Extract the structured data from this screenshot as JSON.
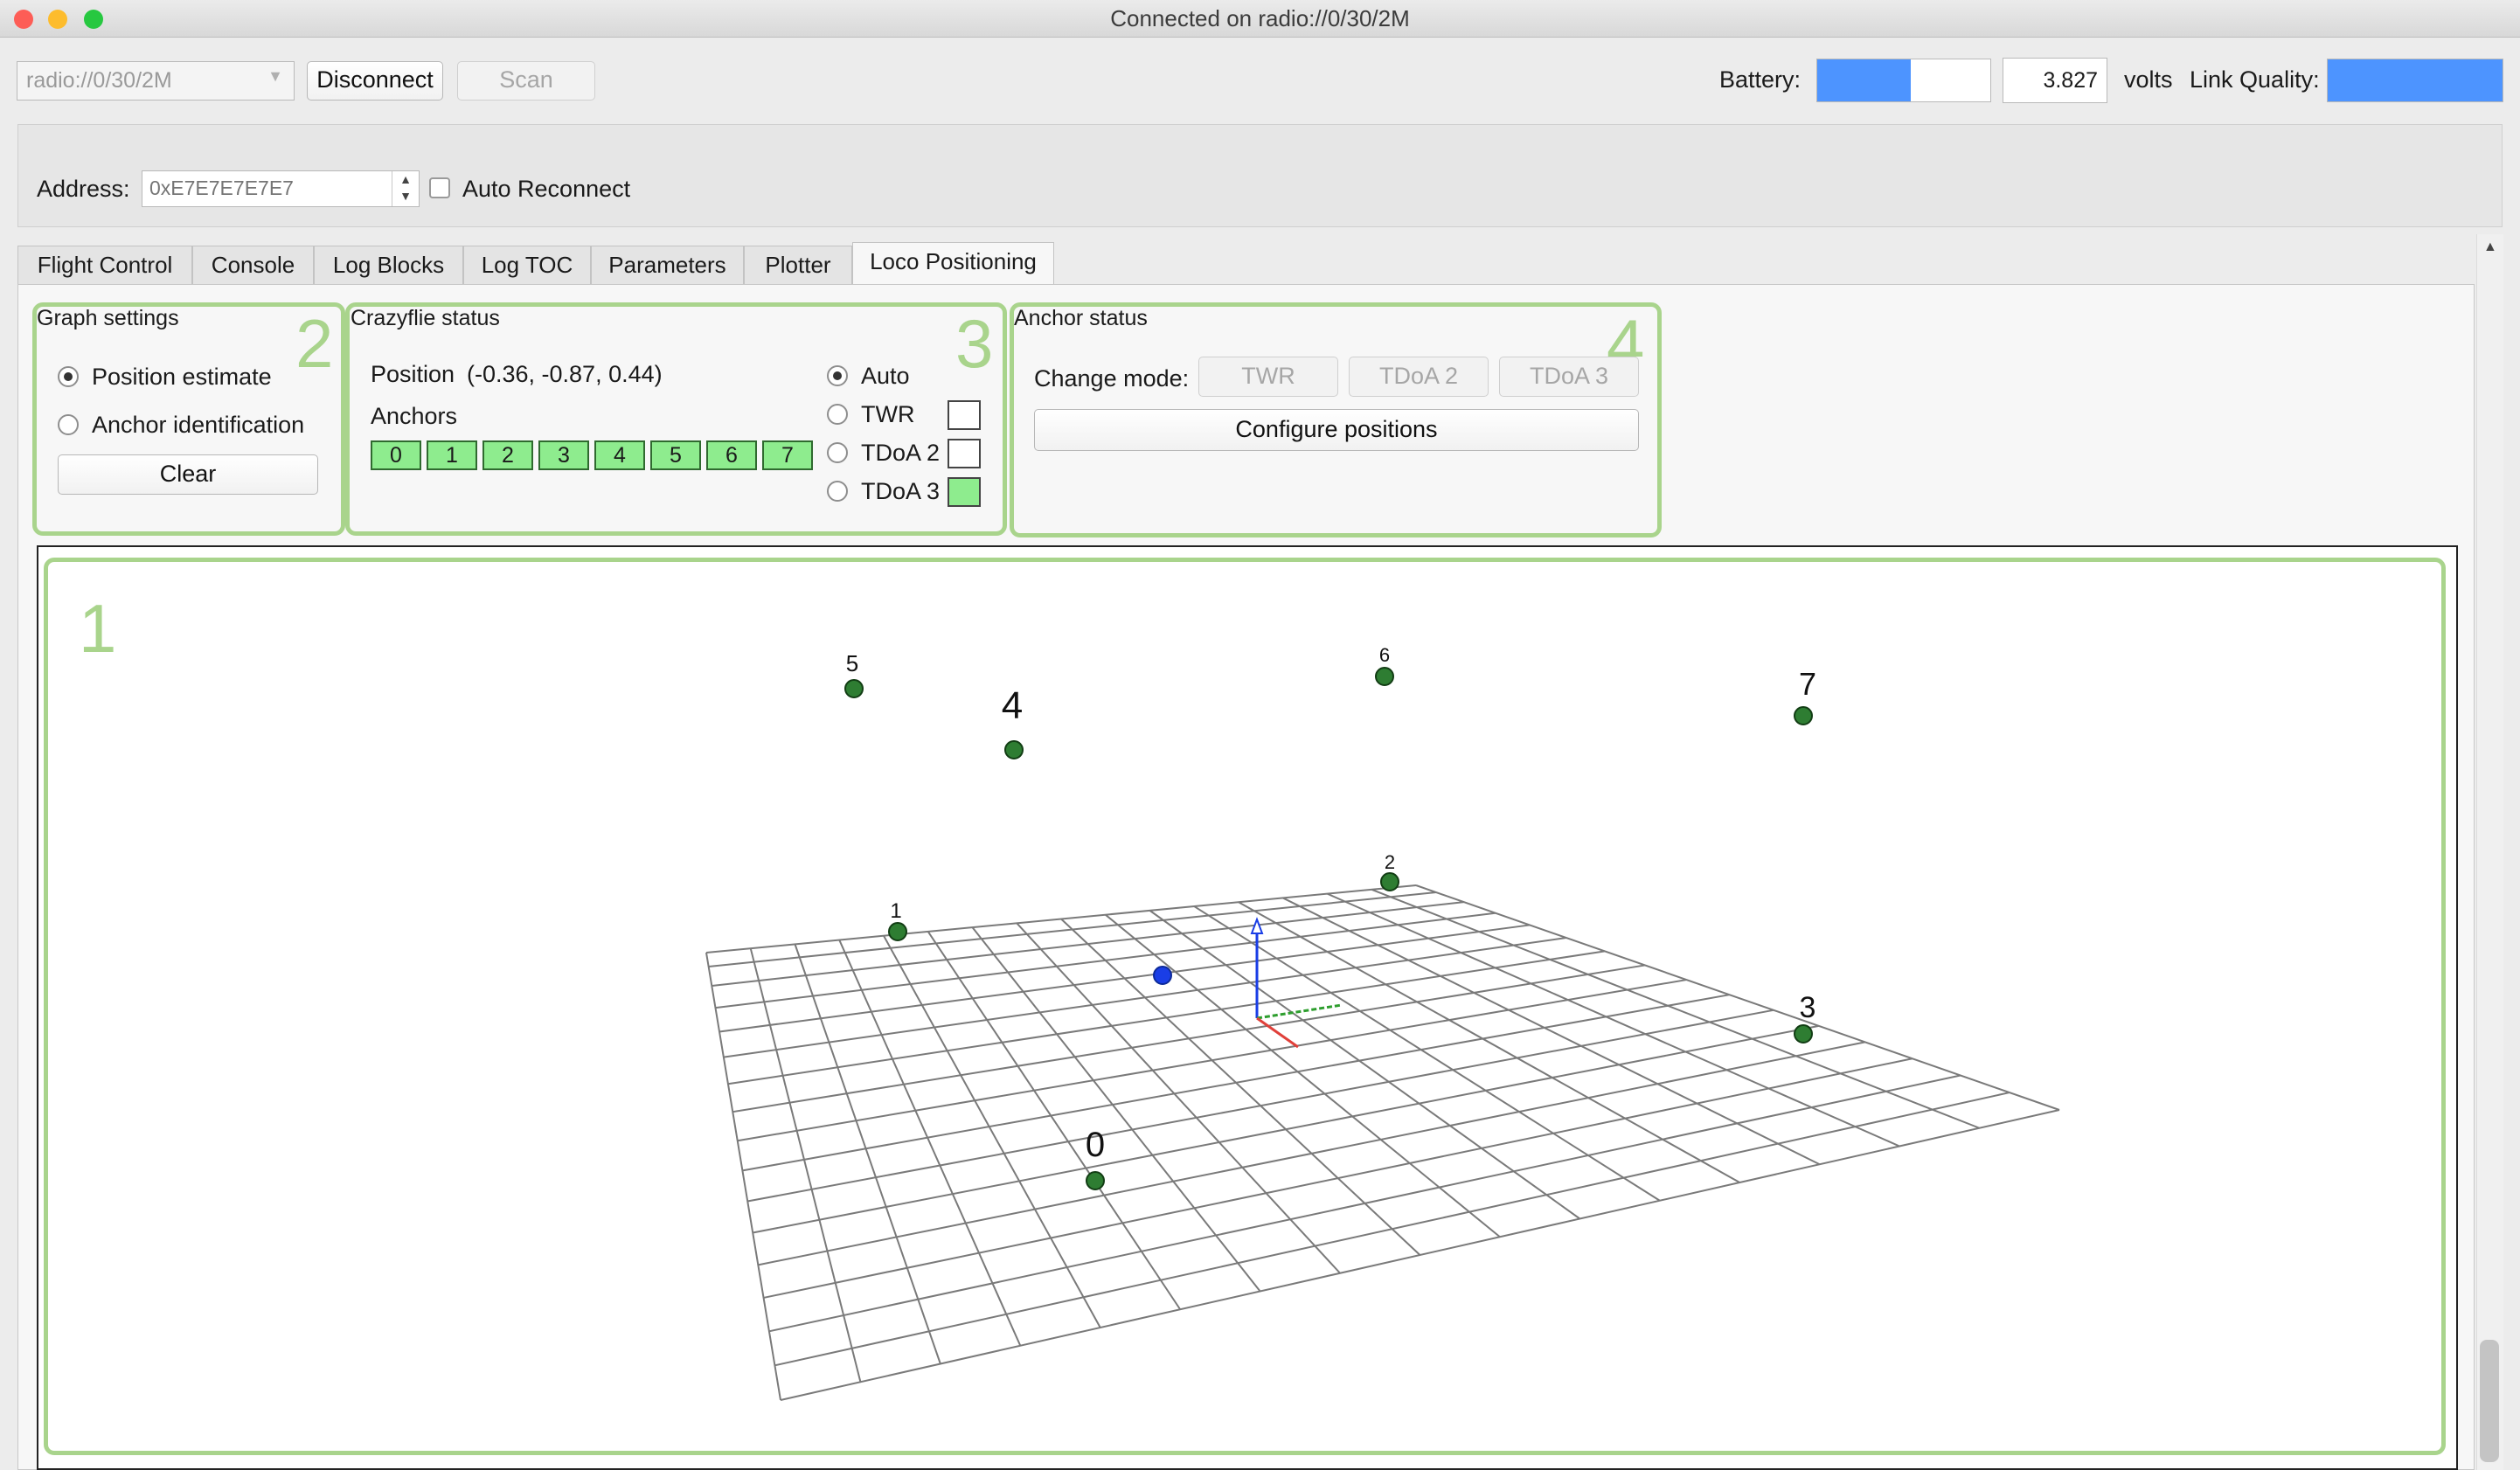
{
  "window": {
    "title": "Connected on radio://0/30/2M",
    "traffic_lights": [
      "#fd5d56",
      "#fdbc2d",
      "#27c840"
    ]
  },
  "toolbar": {
    "interface_value": "radio://0/30/2M",
    "disconnect_label": "Disconnect",
    "scan_label": "Scan",
    "battery_label": "Battery:",
    "battery_level_fraction": 0.54,
    "voltage_value": "3.827",
    "volts_label": "volts",
    "link_quality_label": "Link Quality:",
    "link_quality_fraction": 1.0,
    "bar_color": "#4d94ff"
  },
  "address_bar": {
    "address_label": "Address:",
    "address_placeholder": "0xE7E7E7E7E7",
    "auto_reconnect_label": "Auto Reconnect"
  },
  "tabs": [
    "Flight Control",
    "Console",
    "Log Blocks",
    "Log TOC",
    "Parameters",
    "Plotter",
    "Loco Positioning"
  ],
  "active_tab": "Loco Positioning",
  "graph_settings": {
    "title": "Graph settings",
    "number": "2",
    "options": [
      {
        "label": "Position estimate",
        "selected": true
      },
      {
        "label": "Anchor identification",
        "selected": false
      }
    ],
    "clear_label": "Clear"
  },
  "crazyflie_status": {
    "title": "Crazyflie status",
    "number": "3",
    "position_label": "Position",
    "position_value": "(-0.36, -0.87, 0.44)",
    "anchors_label": "Anchors",
    "anchors": [
      "0",
      "1",
      "2",
      "3",
      "4",
      "5",
      "6",
      "7"
    ],
    "modes": [
      {
        "label": "Auto",
        "selected": true,
        "indicator": null
      },
      {
        "label": "TWR",
        "selected": false,
        "indicator": "off"
      },
      {
        "label": "TDoA 2",
        "selected": false,
        "indicator": "off"
      },
      {
        "label": "TDoA 3",
        "selected": false,
        "indicator": "on"
      }
    ],
    "indicator_on_color": "#8eec8e"
  },
  "anchor_status": {
    "title": "Anchor status",
    "number": "4",
    "change_mode_label": "Change mode:",
    "mode_buttons": [
      "TWR",
      "TDoA 2",
      "TDoA 3"
    ],
    "configure_label": "Configure positions"
  },
  "graph": {
    "number": "1",
    "anchor_labels": [
      "0",
      "1",
      "2",
      "3",
      "4",
      "5",
      "6",
      "7"
    ],
    "anchor_color": "#2e7d32",
    "position_marker_color": "#1a3ee6",
    "box_color": "#a9d48c"
  }
}
